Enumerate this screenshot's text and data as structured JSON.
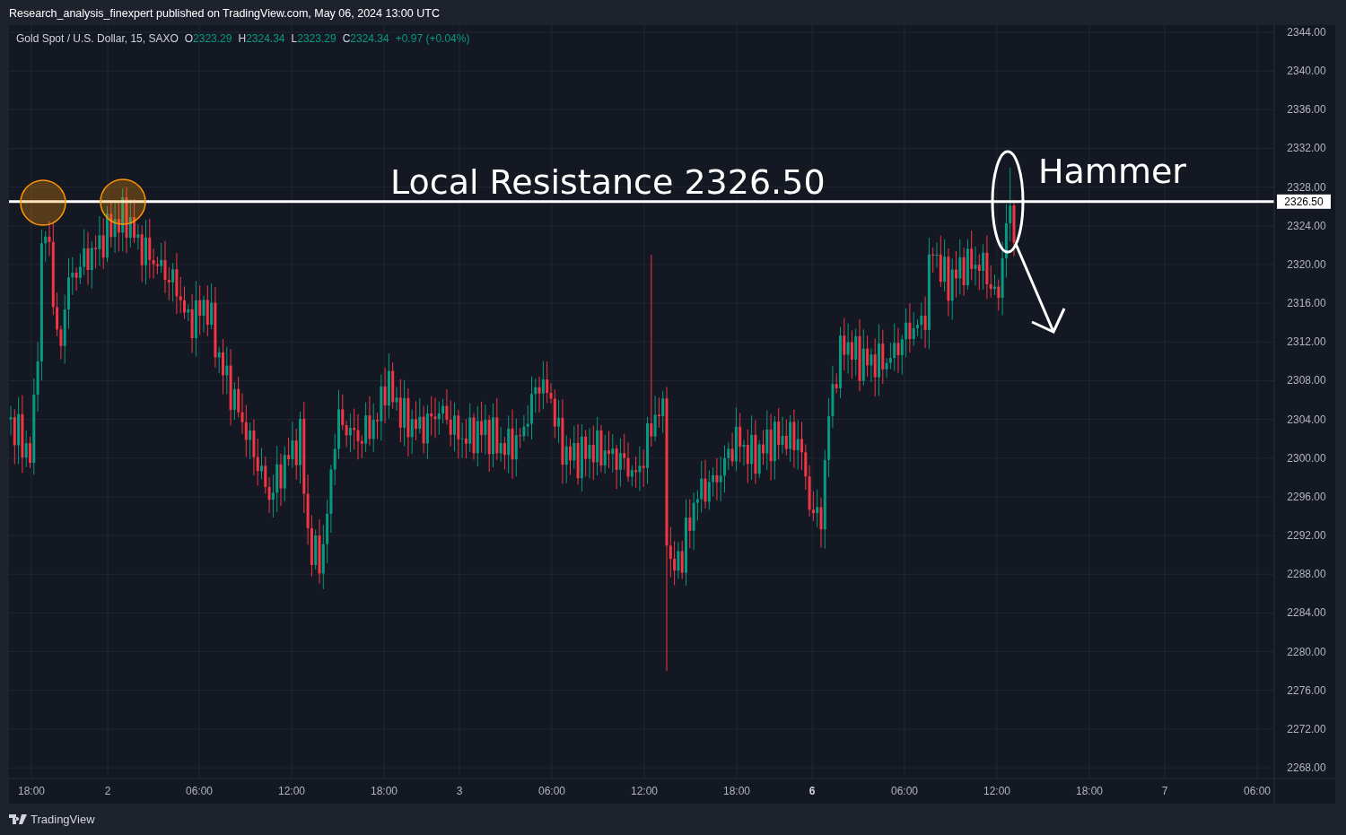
{
  "header": {
    "text": "Research_analysis_finexpert published on TradingView.com, May 06, 2024 13:00 UTC"
  },
  "legend": {
    "symbol": "Gold Spot / U.S. Dollar, 15, SAXO",
    "values": [
      {
        "label": "O",
        "value": "2323.29"
      },
      {
        "label": "H",
        "value": "2324.34"
      },
      {
        "label": "L",
        "value": "2323.29"
      },
      {
        "label": "C",
        "value": "2324.34"
      }
    ],
    "change": "+0.97 (+0.04%)"
  },
  "price_axis": [
    "2344.00",
    "2340.00",
    "2336.00",
    "2332.00",
    "2328.00",
    "2324.00",
    "2320.00",
    "2316.00",
    "2312.00",
    "2308.00",
    "2304.00",
    "2300.00",
    "2296.00",
    "2292.00",
    "2288.00",
    "2284.00",
    "2280.00",
    "2276.00",
    "2272.00",
    "2268.00"
  ],
  "time_axis": [
    {
      "label": "18:00",
      "bold": false
    },
    {
      "label": "2",
      "bold": false
    },
    {
      "label": "06:00",
      "bold": false
    },
    {
      "label": "12:00",
      "bold": false
    },
    {
      "label": "18:00",
      "bold": false
    },
    {
      "label": "3",
      "bold": false
    },
    {
      "label": "06:00",
      "bold": false
    },
    {
      "label": "12:00",
      "bold": false
    },
    {
      "label": "18:00",
      "bold": false
    },
    {
      "label": "6",
      "bold": true
    },
    {
      "label": "06:00",
      "bold": false
    },
    {
      "label": "12:00",
      "bold": false
    },
    {
      "label": "18:00",
      "bold": false
    },
    {
      "label": "7",
      "bold": false
    },
    {
      "label": "06:00",
      "bold": false
    }
  ],
  "annotations": {
    "resistance_label": "Local Resistance 2326.50",
    "resistance_price_tag": "2326.50",
    "pattern_label": "Hammer"
  },
  "footer": {
    "brand": "TradingView"
  }
}
